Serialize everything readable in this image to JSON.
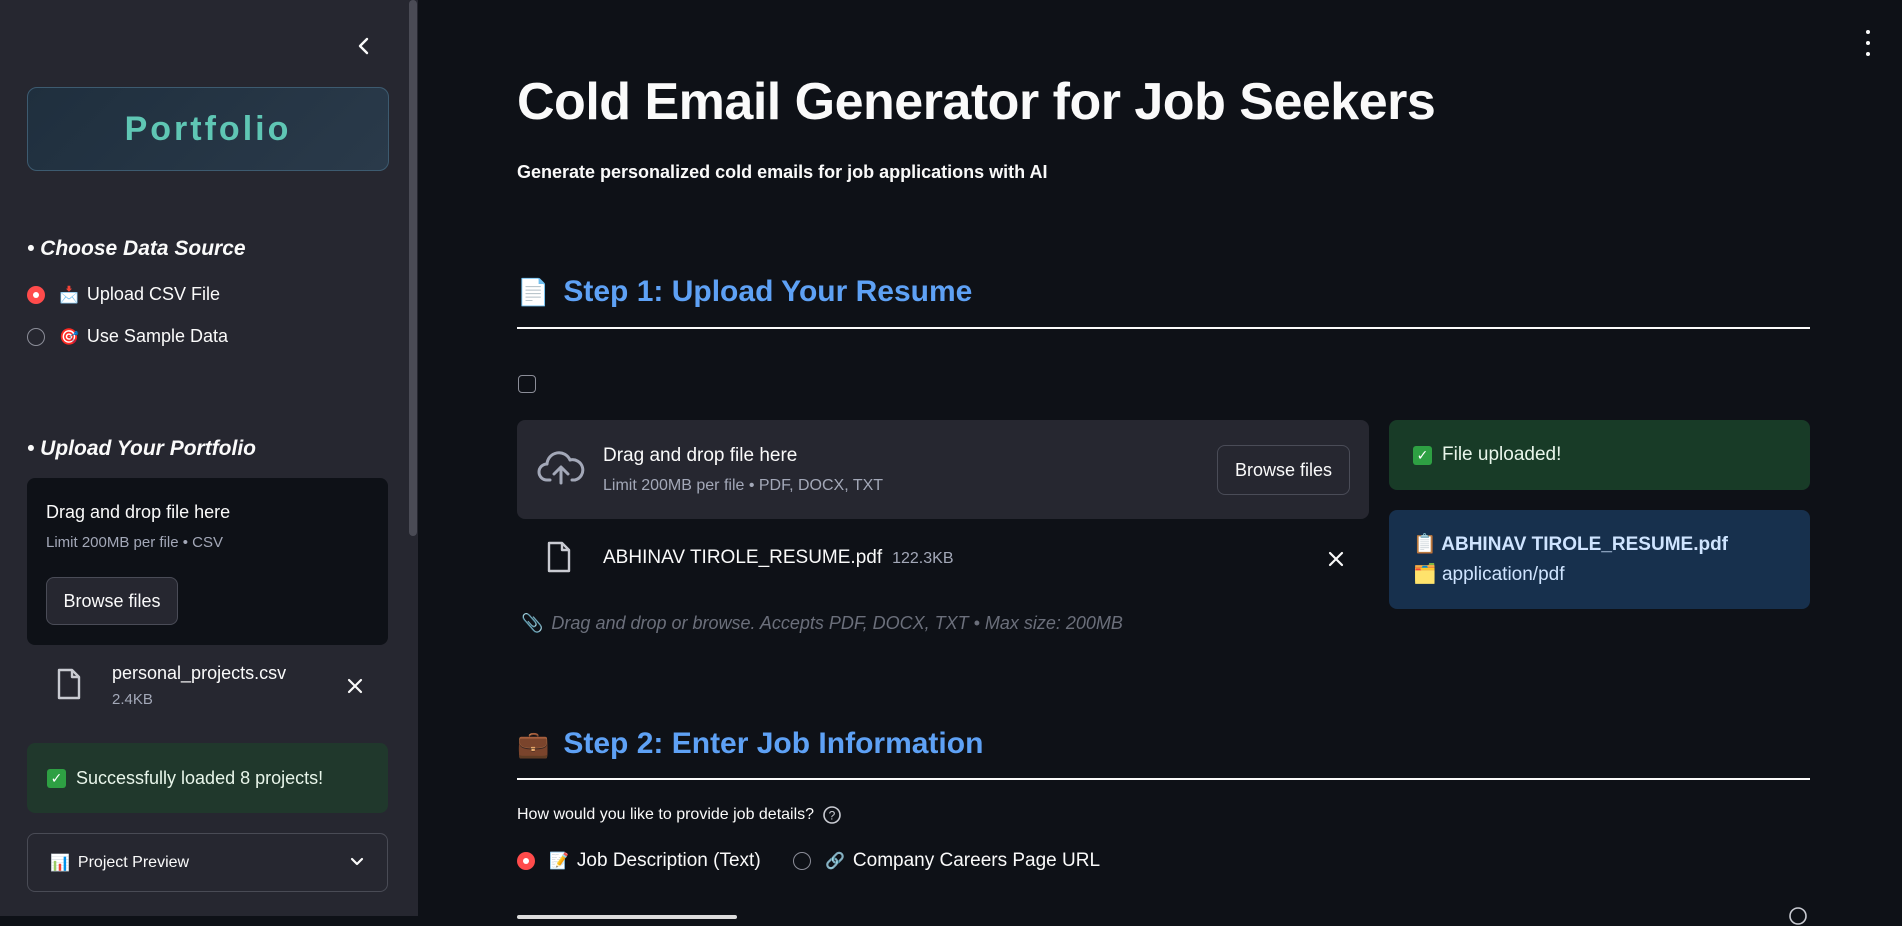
{
  "sidebar": {
    "portfolio_title": "Portfolio",
    "data_source_heading": "• Choose Data Source",
    "data_source_options": [
      {
        "emoji": "📩",
        "label": "Upload CSV File",
        "selected": true
      },
      {
        "emoji": "🎯",
        "label": "Use Sample Data",
        "selected": false
      }
    ],
    "upload_heading": "• Upload Your Portfolio",
    "dropzone": {
      "title": "Drag and drop file here",
      "limit": "Limit 200MB per file • CSV",
      "browse_label": "Browse files"
    },
    "uploaded_file": {
      "name": "personal_projects.csv",
      "size": "2.4KB"
    },
    "success_message": "Successfully loaded 8 projects!",
    "expander": {
      "emoji": "📊",
      "label": "Project Preview"
    }
  },
  "main": {
    "title": "Cold Email Generator for Job Seekers",
    "subtitle": "Generate personalized cold emails for job applications with AI",
    "step1": {
      "emoji": "📄",
      "heading": "Step 1: Upload Your Resume",
      "dropzone": {
        "title": "Drag and drop file here",
        "limit": "Limit 200MB per file • PDF, DOCX, TXT",
        "browse_label": "Browse files"
      },
      "uploaded_file": {
        "name": "ABHINAV TIROLE_RESUME.pdf",
        "size": "122.3KB"
      },
      "hint": "Drag and drop or browse. Accepts PDF, DOCX, TXT • Max size: 200MB",
      "status_success": "File uploaded!",
      "file_info": {
        "name_emoji": "📋",
        "name": "ABHINAV TIROLE_RESUME.pdf",
        "type_emoji": "🗂️",
        "type": "application/pdf"
      }
    },
    "step2": {
      "emoji": "💼",
      "heading": "Step 2: Enter Job Information",
      "question": "How would you like to provide job details?",
      "options": [
        {
          "emoji": "📝",
          "label": "Job Description (Text)",
          "selected": true
        },
        {
          "emoji": "🔗",
          "label": "Company Careers Page URL",
          "selected": false
        }
      ]
    }
  },
  "colors": {
    "background": "#0e1117",
    "sidebar": "#262730",
    "accent_red": "#ff4b4b",
    "heading_blue": "#5ea1f5",
    "portfolio_teal": "#5fc6b4",
    "success_green": "#183b27",
    "info_blue": "#17304d"
  }
}
